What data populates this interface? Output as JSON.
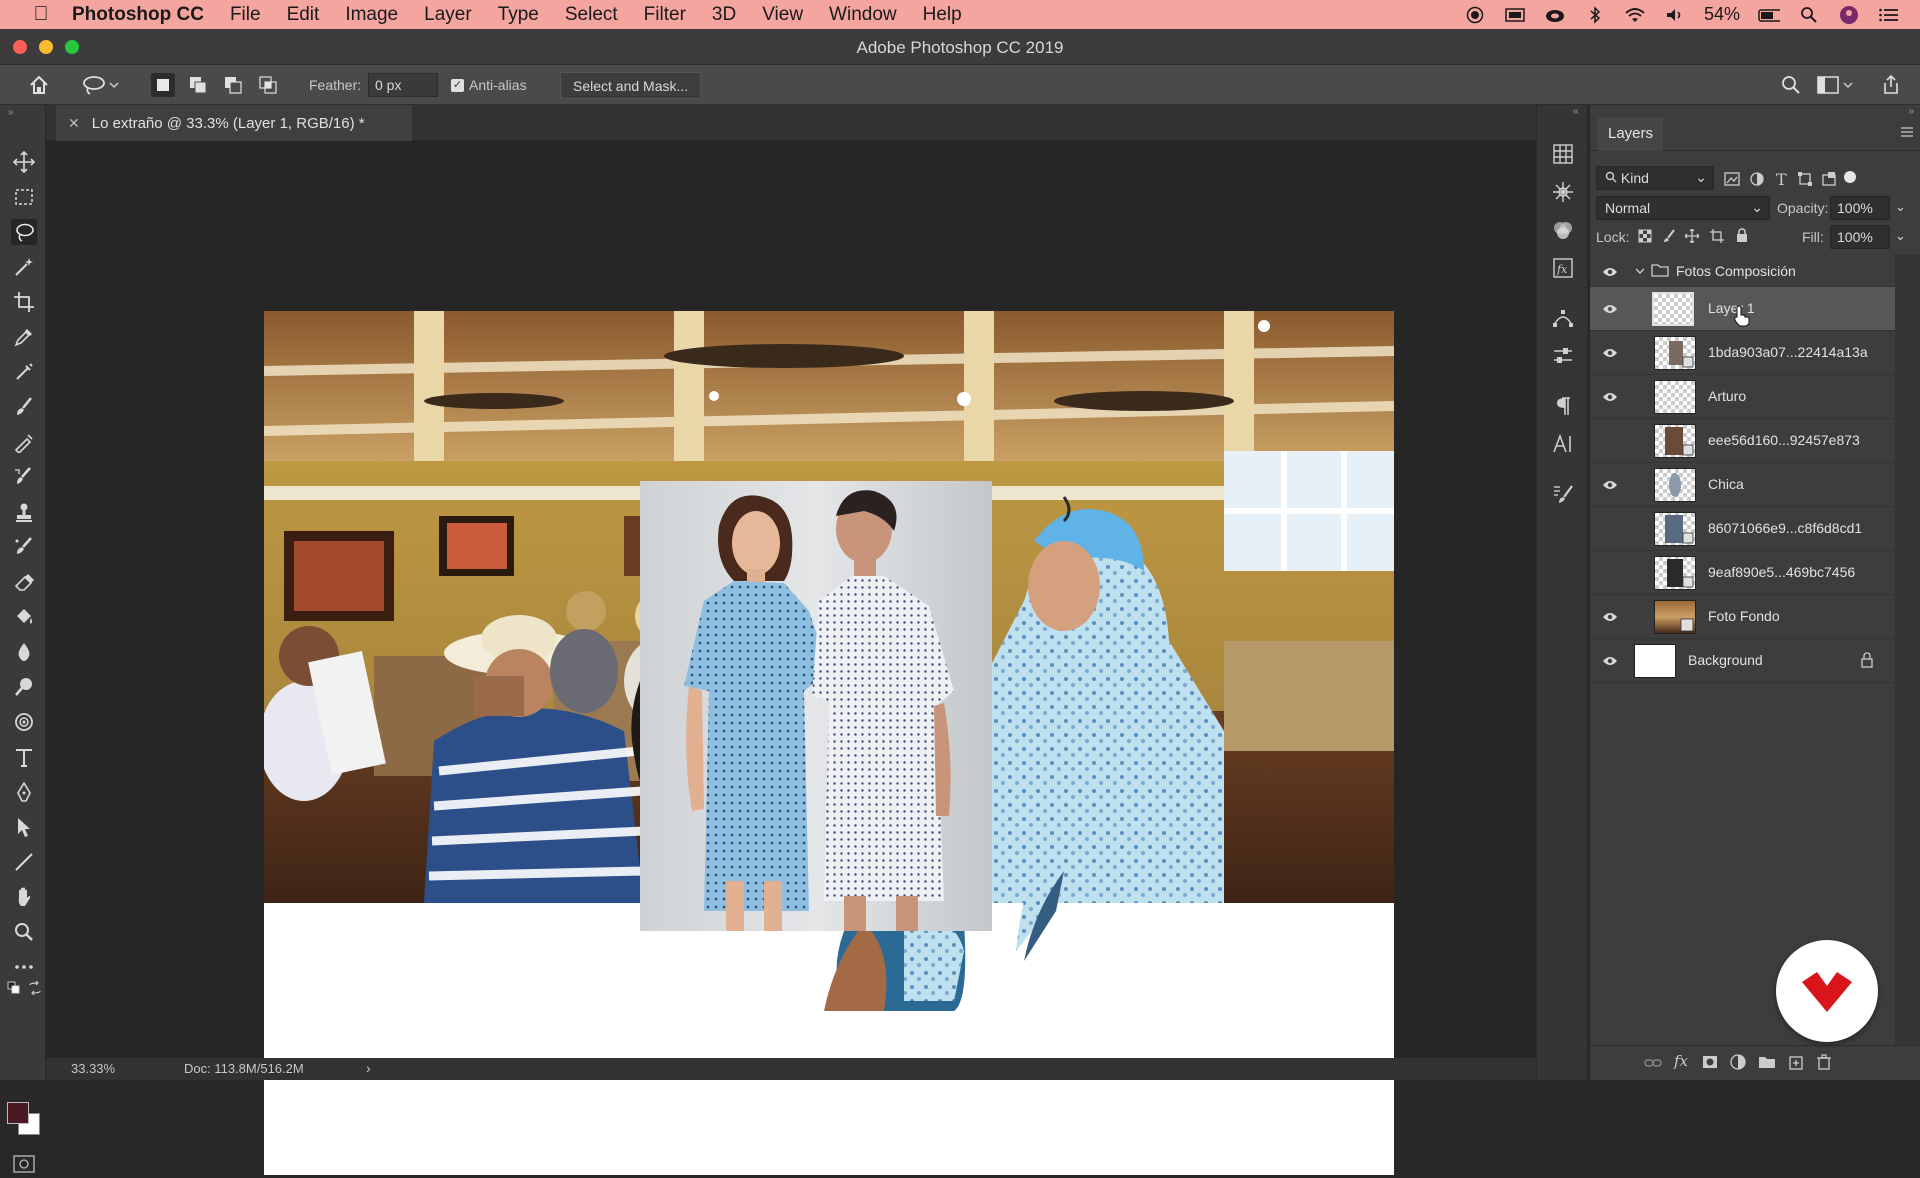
{
  "menubar": {
    "app_name": "Photoshop CC",
    "items": [
      "File",
      "Edit",
      "Image",
      "Layer",
      "Type",
      "Select",
      "Filter",
      "3D",
      "View",
      "Window",
      "Help"
    ],
    "battery": "54%"
  },
  "window": {
    "title": "Adobe Photoshop CC 2019"
  },
  "options": {
    "feather_label": "Feather:",
    "feather_value": "0 px",
    "antialias_label": "Anti-alias",
    "antialias_checked": true,
    "select_mask_label": "Select and Mask..."
  },
  "document": {
    "tab_title": "Lo extraño @ 33.3% (Layer 1, RGB/16) *",
    "zoom": "33.33%",
    "doc_info": "Doc: 113.8M/516.2M"
  },
  "layers_panel": {
    "tab_label": "Layers",
    "filter_kind": "Kind",
    "blend_mode": "Normal",
    "opacity_label": "Opacity:",
    "opacity_value": "100%",
    "lock_label": "Lock:",
    "fill_label": "Fill:",
    "fill_value": "100%",
    "group_name": "Fotos Composición",
    "layers": [
      {
        "name": "Layer 1",
        "visible": true,
        "selected": true,
        "kind": "pixel"
      },
      {
        "name": "1bda903a07...22414a13a",
        "visible": true,
        "kind": "smart"
      },
      {
        "name": "Arturo",
        "visible": true,
        "kind": "pixel"
      },
      {
        "name": "eee56d160...92457e873",
        "visible": false,
        "kind": "smart"
      },
      {
        "name": "Chica",
        "visible": true,
        "kind": "pixel"
      },
      {
        "name": "86071066e9...c8f6d8cd1",
        "visible": false,
        "kind": "smart"
      },
      {
        "name": "9eaf890e5...469bc7456",
        "visible": false,
        "kind": "smart"
      },
      {
        "name": "Foto Fondo",
        "visible": true,
        "kind": "photo"
      }
    ],
    "background_layer": "Background"
  },
  "colors": {
    "menubar_bg": "#f4a5a0",
    "foreground": "#4a1a24",
    "background": "#ffffff",
    "badge_red": "#d9141b"
  }
}
